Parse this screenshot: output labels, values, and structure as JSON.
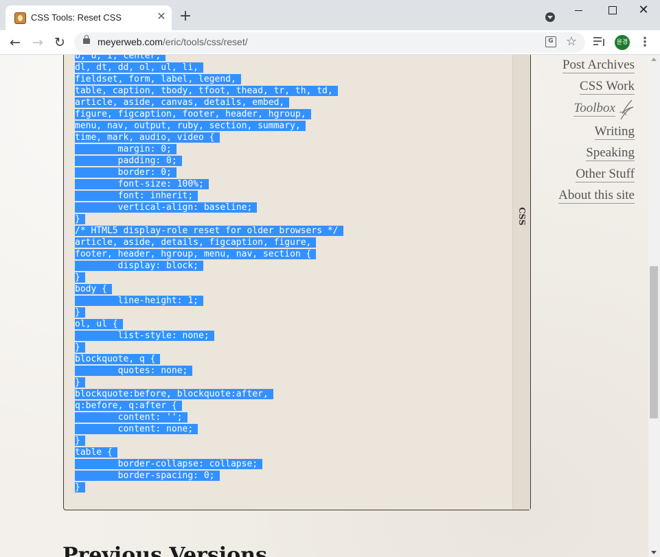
{
  "browser": {
    "tab_title": "CSS Tools: Reset CSS",
    "tab_close": "✕",
    "new_tab": "+",
    "url_host": "meyerweb.com",
    "url_path": "/eric/tools/css/reset/",
    "profile_initials": "윤경",
    "window_close": "✕"
  },
  "code_block": {
    "label": "CSS",
    "lines": [
      "b, u, i, center,",
      "dl, dt, dd, ol, ul, li,",
      "fieldset, form, label, legend,",
      "table, caption, tbody, tfoot, thead, tr, th, td,",
      "article, aside, canvas, details, embed,",
      "figure, figcaption, footer, header, hgroup,",
      "menu, nav, output, ruby, section, summary,",
      "time, mark, audio, video {",
      "\tmargin: 0;",
      "\tpadding: 0;",
      "\tborder: 0;",
      "\tfont-size: 100%;",
      "\tfont: inherit;",
      "\tvertical-align: baseline;",
      "}",
      "/* HTML5 display-role reset for older browsers */",
      "article, aside, details, figcaption, figure,",
      "footer, header, hgroup, menu, nav, section {",
      "\tdisplay: block;",
      "}",
      "body {",
      "\tline-height: 1;",
      "}",
      "ol, ul {",
      "\tlist-style: none;",
      "}",
      "blockquote, q {",
      "\tquotes: none;",
      "}",
      "blockquote:before, blockquote:after,",
      "q:before, q:after {",
      "\tcontent: '';",
      "\tcontent: none;",
      "}",
      "table {",
      "\tborder-collapse: collapse;",
      "\tborder-spacing: 0;",
      "}"
    ]
  },
  "sidenav": {
    "items": [
      {
        "label": "Post Archives"
      },
      {
        "label": "CSS Work"
      },
      {
        "label": "Toolbox"
      },
      {
        "label": "Writing"
      },
      {
        "label": "Speaking"
      },
      {
        "label": "Other Stuff"
      },
      {
        "label": "About this site"
      }
    ]
  },
  "section_heading": "Previous Versions",
  "colors": {
    "selection": "#3391ff",
    "page_background": "#f3f0eb",
    "code_background": "#ebe5db"
  }
}
